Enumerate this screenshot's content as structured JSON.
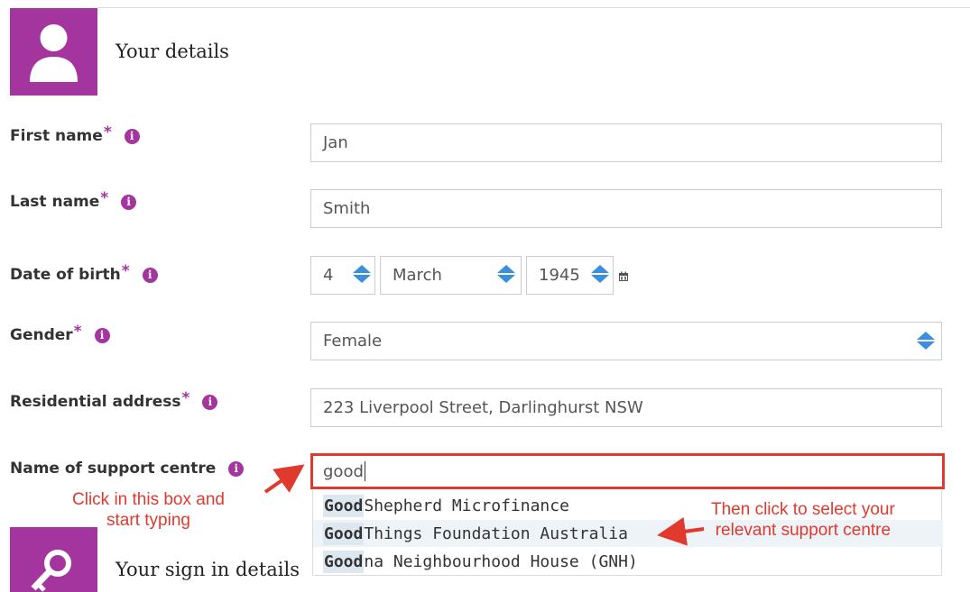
{
  "sections": {
    "details": {
      "heading": "Your details",
      "icon": "user-icon"
    },
    "sign_in": {
      "heading": "Your sign in details",
      "icon": "key-icon"
    }
  },
  "fields": {
    "first_name": {
      "label": "First name",
      "required": "*",
      "value": "Jan"
    },
    "last_name": {
      "label": "Last name",
      "required": "*",
      "value": "Smith"
    },
    "dob": {
      "label": "Date of birth",
      "required": "*",
      "day": "4",
      "month": "March",
      "year": "1945"
    },
    "gender": {
      "label": "Gender",
      "required": "*",
      "value": "Female"
    },
    "address": {
      "label": "Residential address",
      "required": "*",
      "value": "223 Liverpool Street, Darlinghurst NSW"
    },
    "support_centre": {
      "label": "Name of support centre",
      "value": "good"
    }
  },
  "suggestions": [
    {
      "match": "Good",
      "rest": " Shepherd Microfinance"
    },
    {
      "match": "Good",
      "rest": " Things Foundation Australia"
    },
    {
      "match": "Good",
      "rest": "na Neighbourhood House (GNH)"
    }
  ],
  "annotations": {
    "left_line1": "Click in this box and",
    "left_line2": "start typing",
    "right_line1": "Then click to select your",
    "right_line2": "relevant support centre"
  },
  "colors": {
    "brand": "#a4359f",
    "annotation": "#e03a2f",
    "spinner": "#3a8fe0"
  }
}
